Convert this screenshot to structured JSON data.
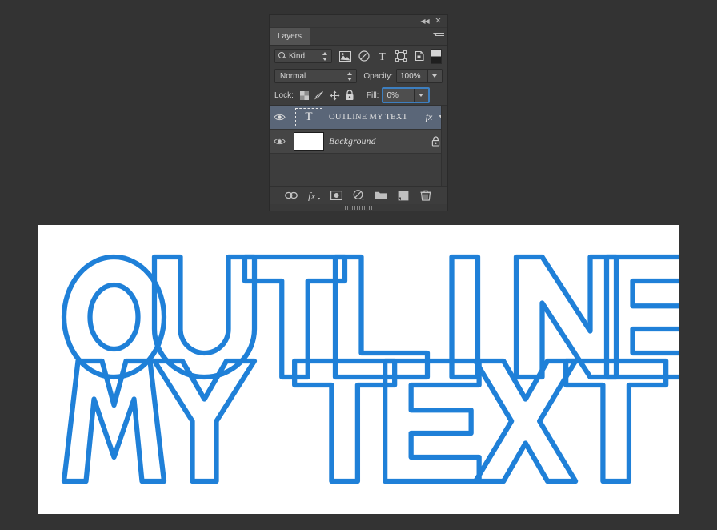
{
  "app": {
    "background_color": "#333333",
    "accent_blue": "#1f80d8"
  },
  "panel": {
    "title_tab": "Layers",
    "titlebar": {
      "collapse_icon": "collapse-to-icons-icon",
      "collapse_glyph": "◀◀",
      "close_icon": "close-icon",
      "close_glyph": "✕"
    },
    "menu_icon": "panel-menu-icon",
    "filter_row": {
      "kind_label": "Kind",
      "search_icon": "magnifier-icon",
      "icons": [
        "pixel-layers-filter-icon",
        "adjustment-layers-filter-icon",
        "type-layers-filter-icon",
        "shape-layers-filter-icon",
        "smart-object-filter-icon"
      ],
      "toggle_icon": "filter-enable-toggle-icon"
    },
    "blend_row": {
      "blend_mode": "Normal",
      "opacity_label": "Opacity:",
      "opacity_value": "100%"
    },
    "lock_row": {
      "lock_label": "Lock:",
      "lock_icons": [
        "lock-transparent-pixels-icon",
        "lock-image-pixels-icon",
        "lock-position-icon",
        "lock-all-icon"
      ],
      "fill_label": "Fill:",
      "fill_value": "0%"
    },
    "layers": [
      {
        "name": "OUTLINE MY TEXT",
        "kind": "type",
        "thumbnail_glyph": "T",
        "visible": true,
        "selected": true,
        "has_effects": true,
        "effects_label": "fx",
        "locked": false
      },
      {
        "name": "Background",
        "kind": "image",
        "visible": true,
        "selected": false,
        "has_effects": false,
        "locked": true
      }
    ],
    "footer_buttons": [
      "link-layers-icon",
      "add-layer-style-icon",
      "add-layer-mask-icon",
      "new-fill-adjustment-layer-icon",
      "new-group-icon",
      "new-layer-icon",
      "delete-layer-icon"
    ],
    "resize_grip": "panel-resize-grip"
  },
  "canvas": {
    "background_color": "#ffffff",
    "text_lines": [
      "OUTLINE",
      "MY TEXT"
    ],
    "full_text": "OUTLINE MY TEXT",
    "stroke_color": "#1f80d8",
    "fill_opacity": "0%",
    "stroke_width": 5
  }
}
